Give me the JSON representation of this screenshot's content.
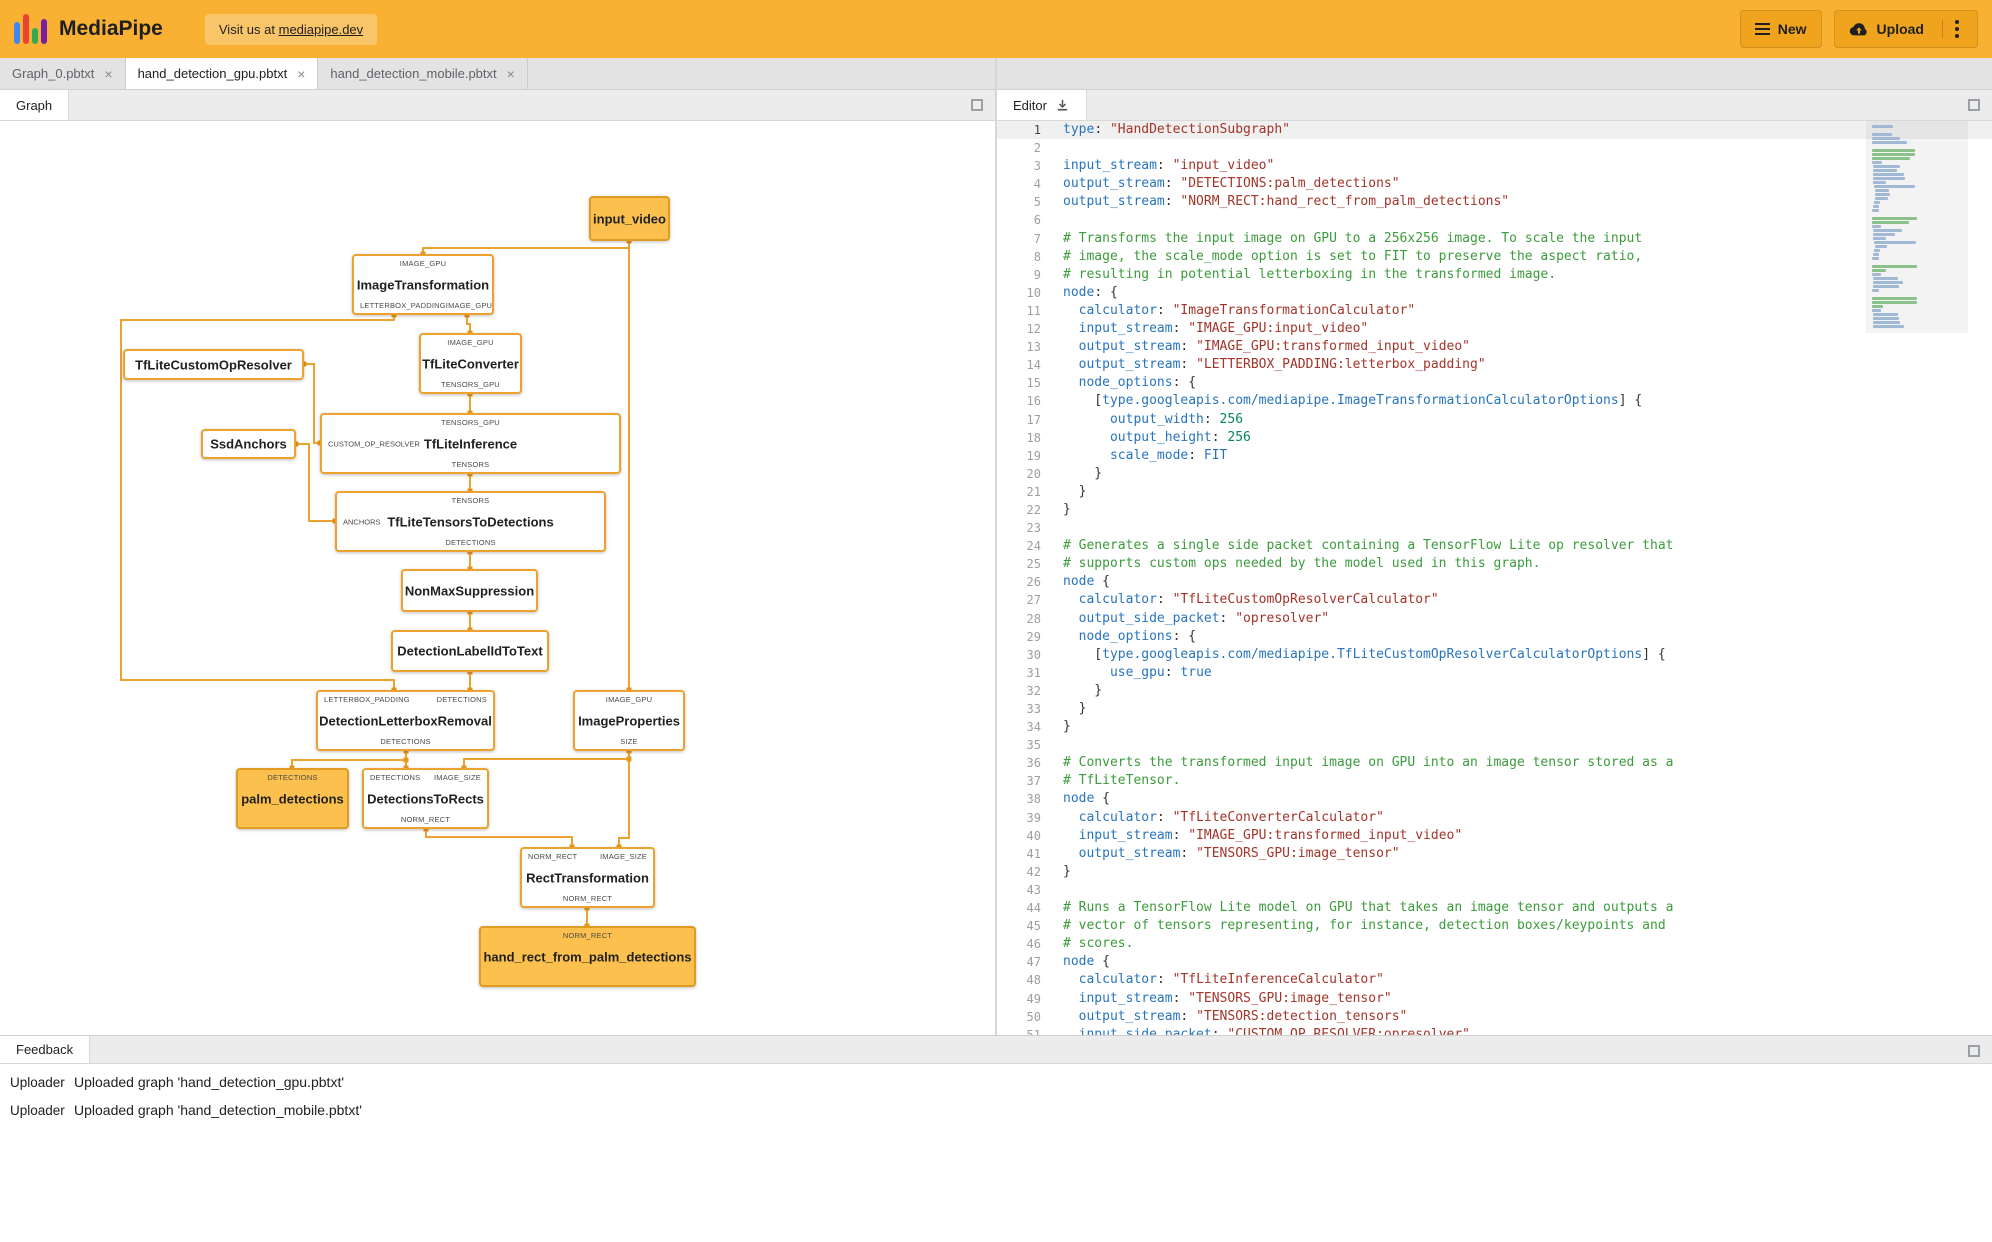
{
  "header": {
    "app_name": "MediaPipe",
    "visit_prefix": "Visit us at ",
    "visit_link": "mediapipe.dev",
    "new_label": "New",
    "upload_label": "Upload"
  },
  "file_tabs": {
    "tab0": "Graph_0.pbtxt",
    "tab1": "hand_detection_gpu.pbtxt",
    "tab2": "hand_detection_mobile.pbtxt",
    "close": "×"
  },
  "panels": {
    "graph_tab": "Graph",
    "editor_tab": "Editor",
    "feedback_tab": "Feedback"
  },
  "feedback": {
    "entries": [
      {
        "source": "Uploader",
        "message": "Uploaded graph 'hand_detection_gpu.pbtxt'"
      },
      {
        "source": "Uploader",
        "message": "Uploaded graph 'hand_detection_mobile.pbtxt'"
      }
    ]
  },
  "colors": {
    "header_bg": "#F8B133",
    "button_bg": "#F0A41E",
    "node_border": "#EDA12E",
    "stream_node_fill": "#FBC04D",
    "edge": "#EDA12E",
    "syntax_key": "#2874BE",
    "syntax_string": "#A3342A",
    "syntax_comment": "#3C9B3C",
    "syntax_number": "#098658"
  },
  "graph": {
    "nodes": {
      "input_video": {
        "label": "input_video"
      },
      "image_transformation": {
        "label": "ImageTransformation",
        "top0": "IMAGE_GPU",
        "bot0": "LETTERBOX_PADDING",
        "bot1": "IMAGE_GPU"
      },
      "tflite_converter": {
        "label": "TfLiteConverter",
        "top0": "IMAGE_GPU",
        "bot0": "TENSORS_GPU"
      },
      "tflite_custom_op_resolver": {
        "label": "TfLiteCustomOpResolver"
      },
      "ssd_anchors": {
        "label": "SsdAnchors"
      },
      "tflite_inference": {
        "label": "TfLiteInference",
        "top0": "TENSORS_GPU",
        "left0": "CUSTOM_OP_RESOLVER",
        "bot0": "TENSORS"
      },
      "tflite_tensors_to_detections": {
        "label": "TfLiteTensorsToDetections",
        "top0": "TENSORS",
        "left0": "ANCHORS",
        "bot0": "DETECTIONS"
      },
      "non_max_suppression": {
        "label": "NonMaxSuppression"
      },
      "detection_label_id_to_text": {
        "label": "DetectionLabelIdToText"
      },
      "detection_letterbox_removal": {
        "label": "DetectionLetterboxRemoval",
        "top0": "LETTERBOX_PADDING",
        "top1": "DETECTIONS",
        "bot0": "DETECTIONS"
      },
      "image_properties": {
        "label": "ImageProperties",
        "top0": "IMAGE_GPU",
        "bot0": "SIZE"
      },
      "palm_detections": {
        "label": "palm_detections",
        "top0": "DETECTIONS"
      },
      "detections_to_rects": {
        "label": "DetectionsToRects",
        "top0": "DETECTIONS",
        "top1": "IMAGE_SIZE",
        "bot0": "NORM_RECT"
      },
      "rect_transformation": {
        "label": "RectTransformation",
        "top0": "NORM_RECT",
        "top1": "IMAGE_SIZE",
        "bot0": "NORM_RECT"
      },
      "hand_rect_from_palm_detections": {
        "label": "hand_rect_from_palm_detections",
        "top0": "NORM_RECT"
      }
    }
  },
  "editor": {
    "lines": [
      "type: \"HandDetectionSubgraph\"",
      "",
      "input_stream: \"input_video\"",
      "output_stream: \"DETECTIONS:palm_detections\"",
      "output_stream: \"NORM_RECT:hand_rect_from_palm_detections\"",
      "",
      "# Transforms the input image on GPU to a 256x256 image. To scale the input",
      "# image, the scale_mode option is set to FIT to preserve the aspect ratio,",
      "# resulting in potential letterboxing in the transformed image.",
      "node: {",
      "  calculator: \"ImageTransformationCalculator\"",
      "  input_stream: \"IMAGE_GPU:input_video\"",
      "  output_stream: \"IMAGE_GPU:transformed_input_video\"",
      "  output_stream: \"LETTERBOX_PADDING:letterbox_padding\"",
      "  node_options: {",
      "    [type.googleapis.com/mediapipe.ImageTransformationCalculatorOptions] {",
      "      output_width: 256",
      "      output_height: 256",
      "      scale_mode: FIT",
      "    }",
      "  }",
      "}",
      "",
      "# Generates a single side packet containing a TensorFlow Lite op resolver that",
      "# supports custom ops needed by the model used in this graph.",
      "node {",
      "  calculator: \"TfLiteCustomOpResolverCalculator\"",
      "  output_side_packet: \"opresolver\"",
      "  node_options: {",
      "    [type.googleapis.com/mediapipe.TfLiteCustomOpResolverCalculatorOptions] {",
      "      use_gpu: true",
      "    }",
      "  }",
      "}",
      "",
      "# Converts the transformed input image on GPU into an image tensor stored as a",
      "# TfLiteTensor.",
      "node {",
      "  calculator: \"TfLiteConverterCalculator\"",
      "  input_stream: \"IMAGE_GPU:transformed_input_video\"",
      "  output_stream: \"TENSORS_GPU:image_tensor\"",
      "}",
      "",
      "# Runs a TensorFlow Lite model on GPU that takes an image tensor and outputs a",
      "# vector of tensors representing, for instance, detection boxes/keypoints and",
      "# scores.",
      "node {",
      "  calculator: \"TfLiteInferenceCalculator\"",
      "  input_stream: \"TENSORS_GPU:image_tensor\"",
      "  output_stream: \"TENSORS:detection_tensors\"",
      "  input_side_packet: \"CUSTOM_OP_RESOLVER:opresolver\""
    ]
  }
}
